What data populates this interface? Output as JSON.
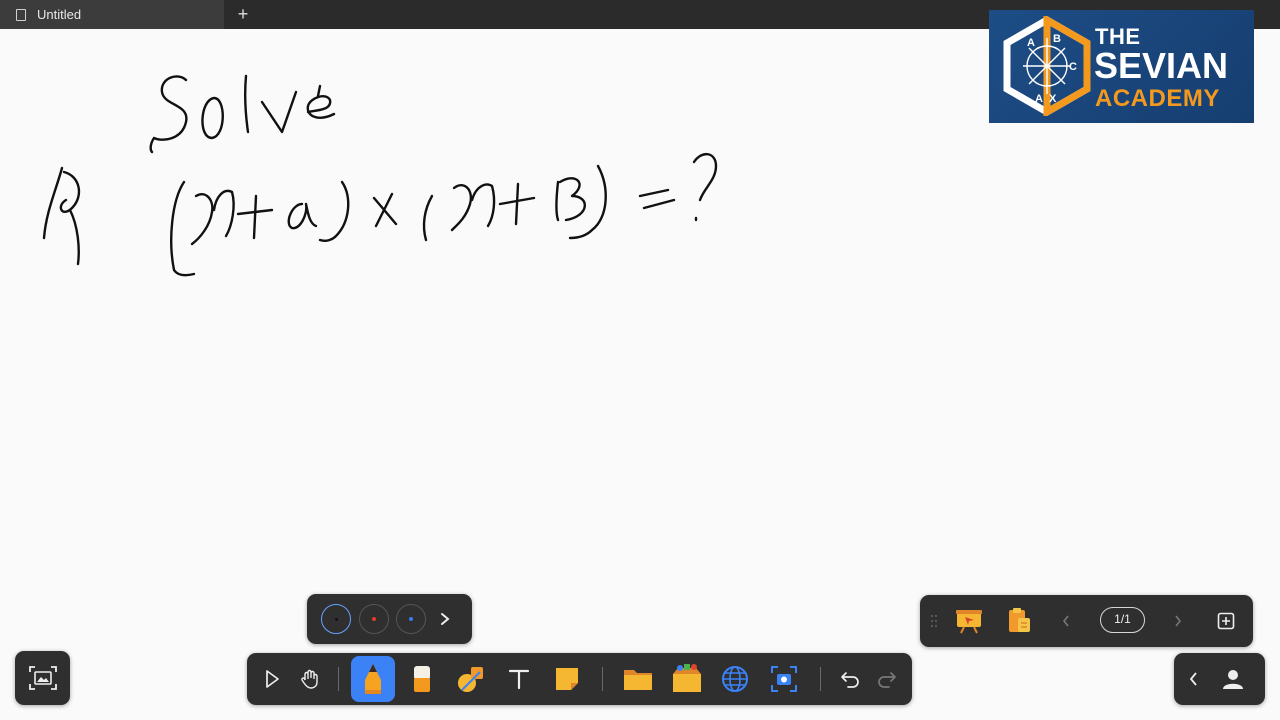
{
  "titlebar": {
    "tab_label": "Untitled",
    "new_tab_label": "+"
  },
  "logo": {
    "line1": "THE",
    "line2": "SEVIAN",
    "line3": "ACADEMY",
    "hex_letters": [
      "A",
      "B",
      "C",
      "A",
      "X"
    ],
    "brand_blue": "#1d4d86",
    "brand_orange": "#f39a1e"
  },
  "palette": {
    "colors": [
      "#2f2f2f",
      "#e23b2e",
      "#3a7bef"
    ],
    "selected_index": 0,
    "more_icon": "chevron-right-icon"
  },
  "page_nav": {
    "page_label": "1/1",
    "icons": [
      "presentation-icon",
      "clipboard-icon",
      "chevron-left-icon",
      "chevron-right-icon",
      "add-page-icon"
    ]
  },
  "toolbar": {
    "tools": [
      "select-icon",
      "hand-icon",
      "pen-icon",
      "eraser-icon",
      "shapes-icon",
      "text-icon",
      "sticky-note-icon",
      "folder-icon",
      "media-icon",
      "browser-icon",
      "capture-icon",
      "undo-icon",
      "redo-icon"
    ],
    "active_tool": "pen-icon",
    "accent": "#3b82f6"
  },
  "side": {
    "left_icon": "screenshot-icon",
    "right_icons": [
      "chevron-left-icon",
      "user-icon"
    ]
  }
}
